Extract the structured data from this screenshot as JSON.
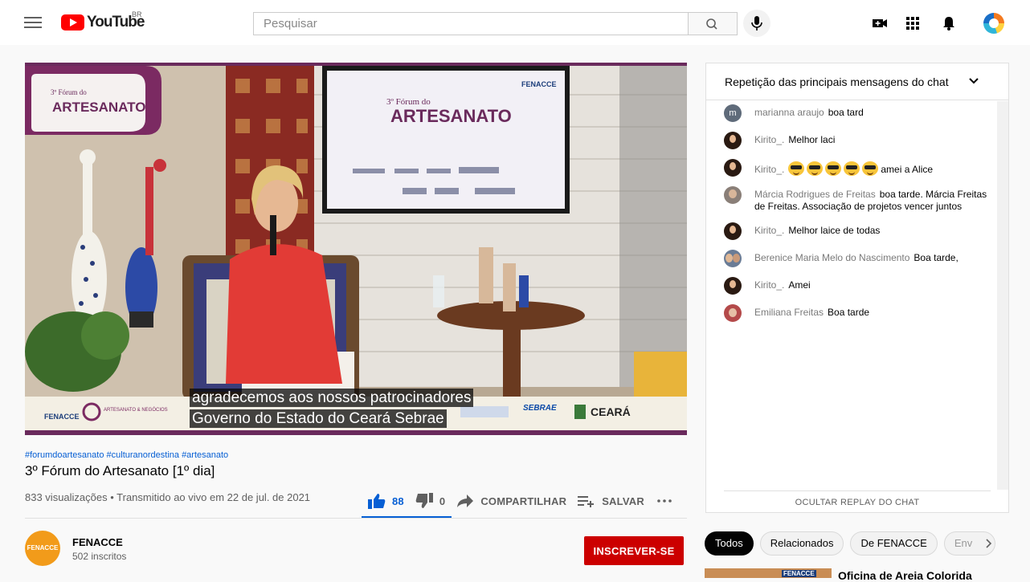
{
  "header": {
    "logo_text": "YouTube",
    "country": "BR",
    "search_placeholder": "Pesquisar"
  },
  "video": {
    "captions": [
      "agradecemos aos nossos patrocinadores",
      "Governo do Estado do Ceará Sebrae"
    ],
    "hashtags": "#forumdoartesanato #culturanordestina #artesanato",
    "title": "3º Fórum do Artesanato [1º dia]",
    "stats": "833 visualizações • Transmitido ao vivo em 22 de jul. de 2021",
    "likes": "88",
    "dislikes": "0",
    "share_label": "COMPARTILHAR",
    "save_label": "SALVAR"
  },
  "channel": {
    "name": "FENACCE",
    "subscribers": "502 inscritos",
    "subscribe_label": "INSCREVER-SE",
    "avatar_text": "FENACCE"
  },
  "chat": {
    "header": "Repetição das principais mensagens do chat",
    "hide_label": "OCULTAR REPLAY DO CHAT",
    "messages": [
      {
        "author": "marianna araujo",
        "text": "boa tard",
        "avatar_letter": "m",
        "avatar_color": "#5f6b7a"
      },
      {
        "author": "Kirito_.",
        "text": "Melhor laci",
        "avatar_color": "#2a1a12"
      },
      {
        "author": "Kirito_.",
        "text": "amei a Alice",
        "avatar_color": "#2a1a12",
        "emoji_count": 5
      },
      {
        "author": "Márcia Rodrigues de Freitas",
        "text": "boa tarde. Márcia Freitas de Freitas. Associação de projetos vencer juntos",
        "avatar_color": "#8a7f78"
      },
      {
        "author": "Kirito_.",
        "text": "Melhor laice de todas",
        "avatar_color": "#2a1a12"
      },
      {
        "author": "Berenice Maria Melo do Nascimento",
        "text": "Boa tarde,",
        "avatar_color": "#6a7c96"
      },
      {
        "author": "Kirito_.",
        "text": "Amei",
        "avatar_color": "#2a1a12"
      },
      {
        "author": "Emiliana Freitas",
        "text": "Boa tarde",
        "avatar_color": "#b44a4a"
      }
    ]
  },
  "chips": [
    "Todos",
    "Relacionados",
    "De FENACCE",
    "Env"
  ],
  "recommendation": {
    "title": "Oficina de Areia Colorida",
    "thumb_label": "FENACCE"
  },
  "scene": {
    "poster_line1": "3º Fórum do",
    "poster_line2": "ARTESANATO",
    "tv_line1": "3º Fórum do",
    "tv_line2": "ARTESANATO",
    "tv_brand": "FENACCE",
    "bottom_logo1": "FENACCE",
    "bottom_logo2": "ARTESANATO & NEGÓCIOS",
    "bottom_sebrae": "SEBRAE",
    "bottom_ceara": "CEARÁ"
  }
}
